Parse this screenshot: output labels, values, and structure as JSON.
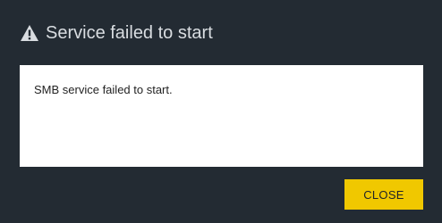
{
  "dialog": {
    "title": "Service failed to start",
    "icon": "warning-icon",
    "message": "SMB service failed to start.",
    "close_label": "CLOSE"
  },
  "colors": {
    "background": "#232b33",
    "title_text": "#d9dde1",
    "body_background": "#ffffff",
    "button_accent": "#f0c800"
  }
}
